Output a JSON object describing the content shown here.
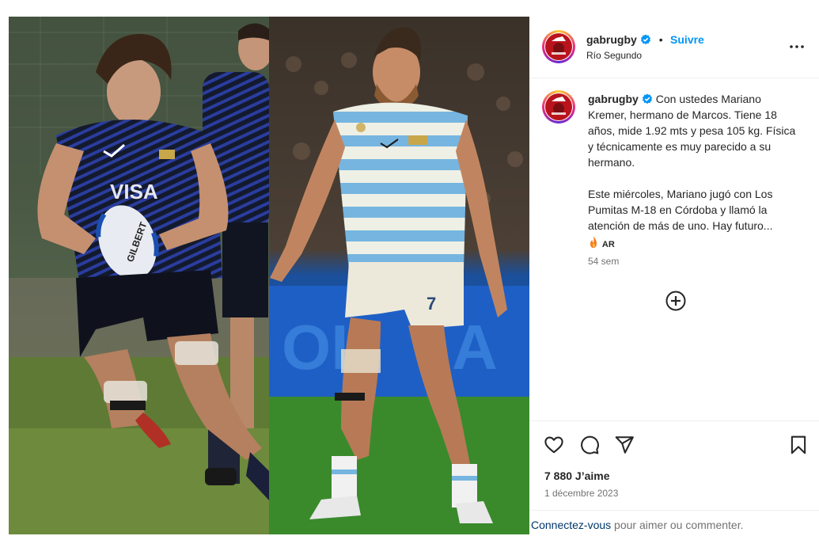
{
  "post": {
    "username": "gabrugby",
    "follow_label": "Suivre",
    "separator": "•",
    "location": "Río Segundo"
  },
  "caption": {
    "username": "gabrugby",
    "paragraph1": "Con ustedes Mariano Kremer, hermano de Marcos. Tiene 18 años, mide 1.92 mts y pesa 105 kg. Física y técnicamente es muy parecido a su hermano.",
    "paragraph2": "Este miércoles, Mariano jugó con Los Pumitas M-18 en Córdoba y llamó la atención de más de uno. Hay futuro...",
    "tag": "AR",
    "time_ago": "54 sem"
  },
  "photo": {
    "left_jersey_text": "VISA",
    "ball_text": "GILBERT",
    "shorts_number": "7"
  },
  "stats": {
    "likes": "7 880 J’aime",
    "date": "1 décembre 2023"
  },
  "footer": {
    "login_link": "Connectez-vous",
    "login_rest": " pour aimer ou commenter."
  },
  "colors": {
    "link_blue": "#0095f6",
    "verified_blue": "#0095f6",
    "muted": "#737373",
    "text": "#262626",
    "divider": "#efefef"
  },
  "icons": {
    "verified": "verified-badge-icon",
    "more": "more-options-icon",
    "add": "add-circle-icon",
    "like": "heart-icon",
    "comment": "comment-icon",
    "share": "share-icon",
    "save": "bookmark-icon",
    "fire": "fire-icon"
  }
}
